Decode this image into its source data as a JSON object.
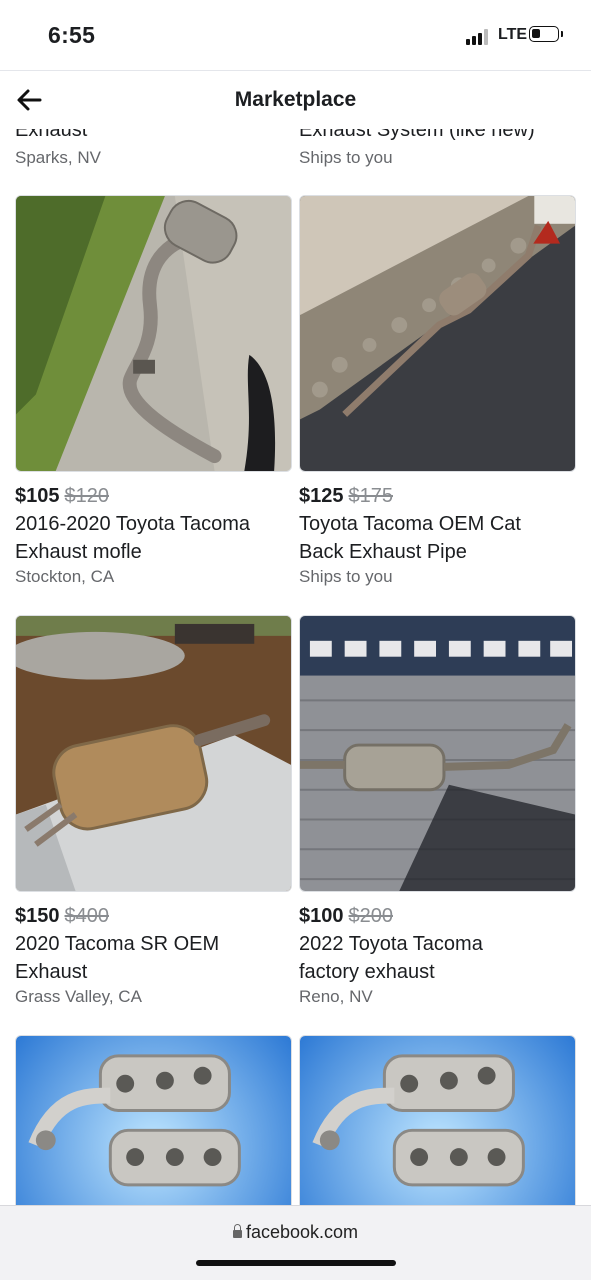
{
  "status": {
    "time": "6:55",
    "network": "LTE",
    "signal_bars": 3,
    "battery_level": 0.35
  },
  "header": {
    "title": "Marketplace",
    "back_icon": "back-arrow-icon"
  },
  "top_row": [
    {
      "title": "Exhaust",
      "location": "Sparks, NV"
    },
    {
      "title": "Exhaust System (like new)",
      "location": "Ships to you"
    }
  ],
  "listings": [
    {
      "price": "$105",
      "old_price": "$120",
      "title_line1": "2016-2020 Toyota Tacoma",
      "title_line2": "Exhaust mofle",
      "location": "Stockton, CA"
    },
    {
      "price": "$125",
      "old_price": "$175",
      "title_line1": "Toyota Tacoma OEM Cat",
      "title_line2": "Back Exhaust Pipe",
      "location": "Ships to you"
    },
    {
      "price": "$150",
      "old_price": "$400",
      "title_line1": "2020 Tacoma SR OEM",
      "title_line2": "Exhaust",
      "location": "Grass Valley, CA"
    },
    {
      "price": "$100",
      "old_price": "$200",
      "title_line1": "2022 Toyota Tacoma",
      "title_line2": "factory exhaust",
      "location": "Reno, NV"
    }
  ],
  "urlbar": {
    "url": "facebook.com",
    "lock_icon": "lock-icon"
  },
  "colors": {
    "text": "#1c1e21",
    "secondary": "#65676b",
    "strike": "#8a8d91",
    "urlbar_bg": "#f2f2f4"
  }
}
